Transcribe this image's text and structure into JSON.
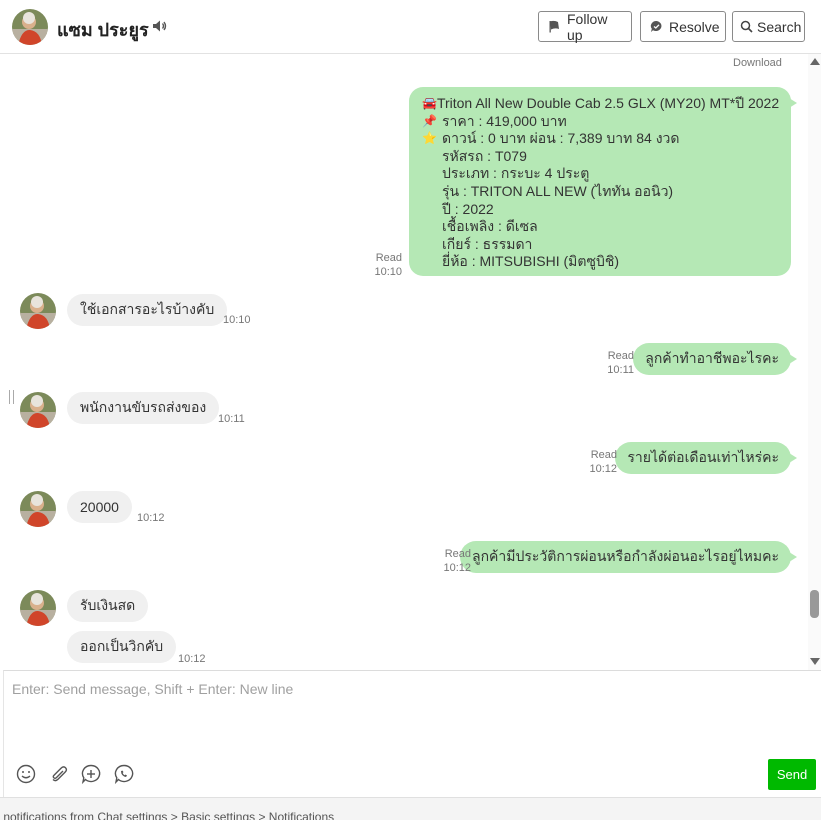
{
  "header": {
    "contact_name": "แซม ประยูร",
    "follow_up_label": "Follow up",
    "resolve_label": "Resolve",
    "search_label": "Search"
  },
  "chat": {
    "download_label": "Download",
    "product_message": {
      "lines": [
        {
          "icon": "🚘",
          "text": "Triton All New Double Cab 2.5 GLX (MY20) MT*ปี 2022"
        },
        {
          "icon": "📌",
          "text": "ราคา : 419,000 บาท"
        },
        {
          "icon": "⭐",
          "text": "ดาวน์ : 0 บาท ผ่อน : 7,389 บาท 84 งวด"
        },
        {
          "icon": "",
          "text": "รหัสรถ : T079"
        },
        {
          "icon": "",
          "text": "ประเภท : กระบะ 4 ประตู"
        },
        {
          "icon": "",
          "text": "รุ่น : TRITON ALL NEW (ไททัน ออนิว)"
        },
        {
          "icon": "",
          "text": "ปี : 2022"
        },
        {
          "icon": "",
          "text": "เชื้อเพลิง : ดีเซล"
        },
        {
          "icon": "",
          "text": "เกียร์ : ธรรมดา"
        },
        {
          "icon": "",
          "text": "ยี่ห้อ : MITSUBISHI (มิตซูบิชิ)"
        }
      ],
      "read": "Read",
      "time": "10:10"
    },
    "messages": [
      {
        "side": "in",
        "text": "ใช้เอกสารอะไรบ้างคับ",
        "time": "10:10"
      },
      {
        "side": "out",
        "text": "ลูกค้าทำอาชีพอะไรคะ",
        "read": "Read",
        "time": "10:11"
      },
      {
        "side": "in",
        "text": "พนักงานขับรถส่งของ",
        "time": "10:11"
      },
      {
        "side": "out",
        "text": "รายได้ต่อเดือนเท่าไหร่คะ",
        "read": "Read",
        "time": "10:12"
      },
      {
        "side": "in",
        "text": "20000",
        "time": "10:12"
      },
      {
        "side": "out",
        "text": "ลูกค้ามีประวัติการผ่อนหรือกำลังผ่อนอะไรอยู่ไหมคะ",
        "read": "Read",
        "time": "10:12"
      },
      {
        "side": "in",
        "text": "รับเงินสด",
        "time": ""
      },
      {
        "side": "in",
        "text": "ออกเป็นวิกคับ",
        "time": "10:12"
      }
    ]
  },
  "composer": {
    "placeholder": "Enter: Send message, Shift + Enter: New line",
    "send_label": "Send"
  },
  "footer": {
    "text": "r notifications from Chat settings > Basic settings > Notifications"
  },
  "colors": {
    "outgoing_bubble": "#b5e8b5",
    "incoming_bubble": "#f0f0f0",
    "send_button": "#00b900"
  }
}
